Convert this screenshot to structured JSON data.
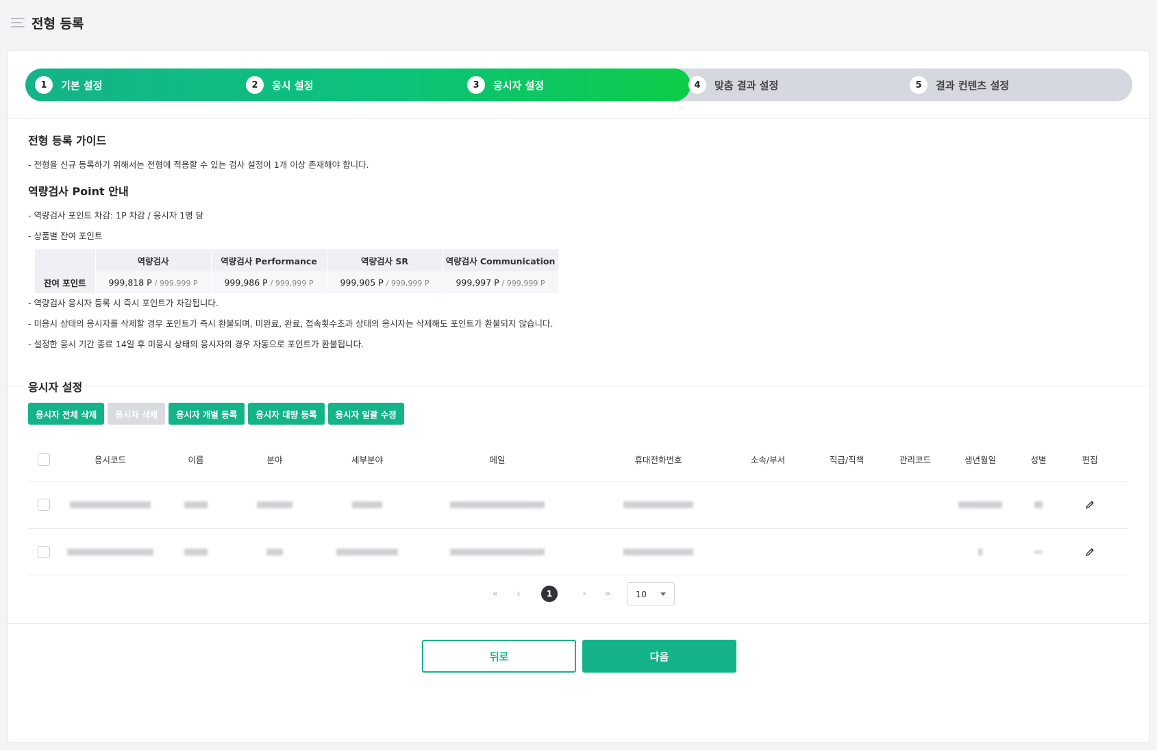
{
  "header": {
    "title": "전형 등록"
  },
  "steps": [
    {
      "num": "1",
      "label": "기본 설정"
    },
    {
      "num": "2",
      "label": "응시 설정"
    },
    {
      "num": "3",
      "label": "응시자 설정"
    },
    {
      "num": "4",
      "label": "맞춤 결과 설정"
    },
    {
      "num": "5",
      "label": "결과 컨텐츠 설정"
    }
  ],
  "guide": {
    "title": "전형 등록 가이드",
    "line1": "- 전형을 신규 등록하기 위해서는 전형에 적용할 수 있는 검사 설정이 1개 이상 존재해야 합니다.",
    "point_title": "역량검사 Point 안내",
    "point_line1": "- 역량검사 포인트 차감: 1P 차감 / 응시자 1명 당",
    "point_line2": "- 상품별 잔여 포인트",
    "notes": [
      "- 역량검사 응시자 등록 시 즉시 포인트가 차감됩니다.",
      "- 미응시 상태의 응시자를 삭제할 경우 포인트가 즉시 환불되며, 미완료, 완료, 접속횟수초과 상태의 응시자는 삭제해도 포인트가 환불되지 않습니다.",
      "- 설정한 응시 기간 종료 14일 후 미응시 상태의 응시자의 경우 자동으로 포인트가 환불됩니다."
    ]
  },
  "points_table": {
    "row_label": "잔여 포인트",
    "columns": [
      {
        "name": "역량검사",
        "value": "999,818 P",
        "max": "/ 999,999 P"
      },
      {
        "name": "역량검사 Performance",
        "value": "999,986 P",
        "max": "/ 999,999 P"
      },
      {
        "name": "역량검사 SR",
        "value": "999,905 P",
        "max": "/ 999,999 P"
      },
      {
        "name": "역량검사 Communication",
        "value": "999,997 P",
        "max": "/ 999,999 P"
      }
    ]
  },
  "applicant": {
    "title": "응시자 설정",
    "buttons": {
      "delete_all": "응시자 전체 삭제",
      "delete": "응시자 삭제",
      "add_single": "응시자 개별 등록",
      "add_bulk": "응시자 대량 등록",
      "edit_bulk": "응시자 일괄 수정"
    },
    "columns": {
      "code": "응시코드",
      "name": "이름",
      "field": "분야",
      "subfield": "세부분야",
      "email": "메일",
      "phone": "휴대전화번호",
      "dept": "소속/부서",
      "position": "직급/직책",
      "mgmt_code": "관리코드",
      "birth": "생년월일",
      "gender": "성별",
      "edit": "편집"
    }
  },
  "pagination": {
    "current": "1",
    "page_size": "10",
    "first": "«",
    "prev": "‹",
    "next": "›",
    "last": "»"
  },
  "footer": {
    "back": "뒤로",
    "next": "다음"
  }
}
